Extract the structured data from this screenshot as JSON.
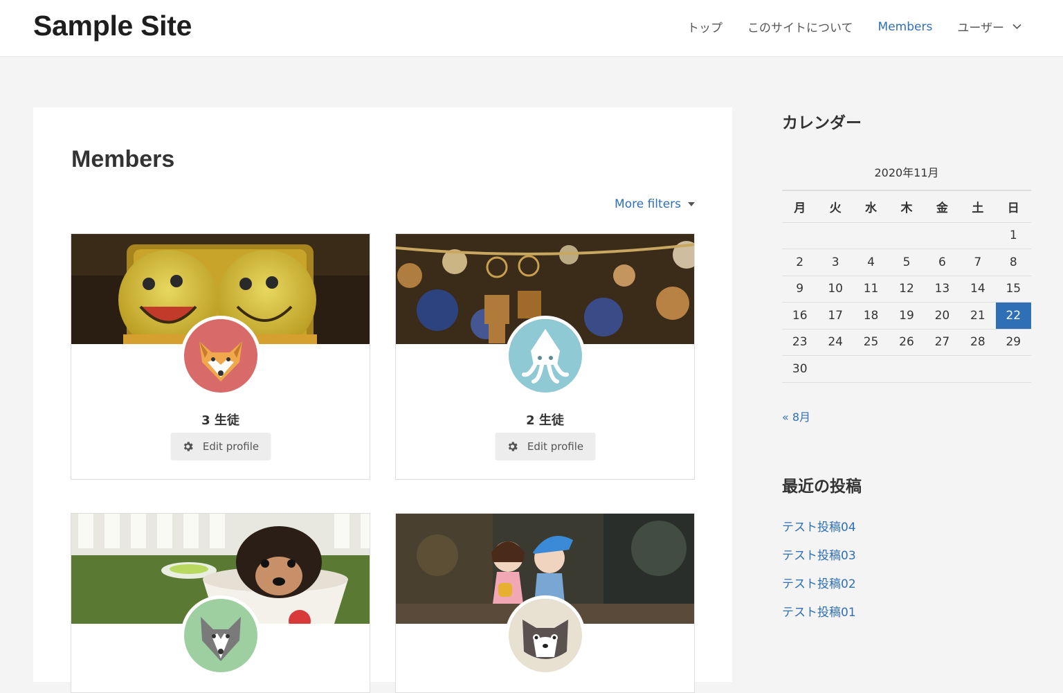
{
  "header": {
    "site_title": "Sample Site",
    "nav": [
      {
        "label": "トップ"
      },
      {
        "label": "このサイトについて"
      },
      {
        "label": "Members"
      },
      {
        "label": "ユーザー"
      }
    ]
  },
  "main": {
    "title": "Members",
    "more_filters": "More filters",
    "cards": [
      {
        "name": "3 生徒",
        "edit_label": "Edit profile"
      },
      {
        "name": "2 生徒",
        "edit_label": "Edit profile"
      },
      {
        "name": "",
        "edit_label": ""
      },
      {
        "name": "",
        "edit_label": ""
      }
    ]
  },
  "sidebar": {
    "calendar_title": "カレンダー",
    "calendar_caption": "2020年11月",
    "weekdays": [
      "月",
      "火",
      "水",
      "木",
      "金",
      "土",
      "日"
    ],
    "weeks": [
      [
        "",
        "",
        "",
        "",
        "",
        "",
        "1"
      ],
      [
        "2",
        "3",
        "4",
        "5",
        "6",
        "7",
        "8"
      ],
      [
        "9",
        "10",
        "11",
        "12",
        "13",
        "14",
        "15"
      ],
      [
        "16",
        "17",
        "18",
        "19",
        "20",
        "21",
        "22"
      ],
      [
        "23",
        "24",
        "25",
        "26",
        "27",
        "28",
        "29"
      ],
      [
        "30",
        "",
        "",
        "",
        "",
        "",
        ""
      ]
    ],
    "today": "22",
    "prev_month": "« 8月",
    "recent_title": "最近の投稿",
    "recent_posts": [
      "テスト投稿04",
      "テスト投稿03",
      "テスト投稿02",
      "テスト投稿01"
    ]
  },
  "colors": {
    "accent": "#2f6fb5"
  }
}
